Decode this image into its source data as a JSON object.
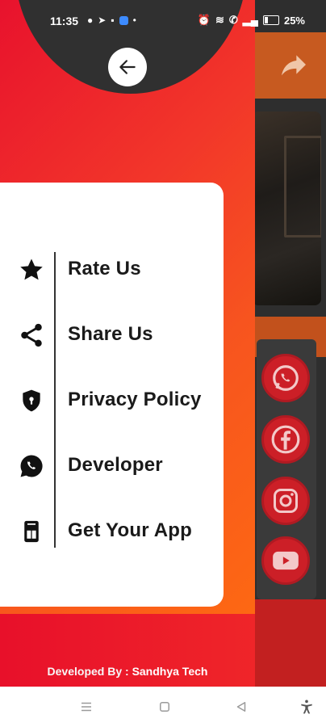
{
  "status_bar": {
    "time": "11:35",
    "battery": "25%"
  },
  "drawer": {
    "menu": [
      {
        "label": "Rate Us",
        "icon": "star-icon"
      },
      {
        "label": "Share Us",
        "icon": "share-icon"
      },
      {
        "label": "Privacy Policy",
        "icon": "shield-icon"
      },
      {
        "label": "Developer",
        "icon": "whatsapp-icon"
      },
      {
        "label": "Get Your App",
        "icon": "phone-app-icon"
      }
    ],
    "footer_prefix": "Developed By : ",
    "footer_name": "Sandhya Tech"
  },
  "background_app": {
    "social_icons": [
      "whatsapp-icon",
      "facebook-icon",
      "instagram-icon",
      "youtube-icon"
    ]
  },
  "colors": {
    "drawer_gradient_start": "#e8122d",
    "drawer_gradient_end": "#ff6d10",
    "social_red": "#cc1f27",
    "dark": "#303030"
  }
}
